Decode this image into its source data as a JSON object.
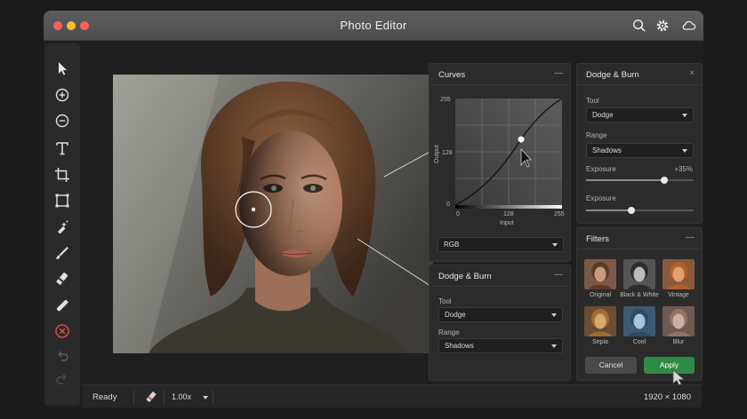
{
  "window": {
    "title": "Photo Editor"
  },
  "colors": {
    "accent": "#2f8a45",
    "panel": "#2b2b2c",
    "traffic": [
      "#ff5f57",
      "#febc2e",
      "#ff5f57"
    ]
  },
  "title_icons": [
    "search-icon",
    "gear-icon",
    "cloud-icon"
  ],
  "toolbar": {
    "tools": [
      "pointer",
      "zoom-in",
      "zoom-out",
      "text",
      "crop",
      "rectangle",
      "healing",
      "brush",
      "eraser",
      "dodge",
      "delete",
      "undo",
      "redo"
    ]
  },
  "curves": {
    "title": "Curves",
    "collapse": "—",
    "y_ticks": [
      "255",
      "128",
      "0"
    ],
    "x_ticks": [
      "0",
      "128",
      "255"
    ],
    "y_label": "Output",
    "x_label": "Input",
    "channel": "RGB"
  },
  "dodge_burn_left": {
    "title": "Dodge & Burn",
    "collapse": "—",
    "tool_label": "Tool",
    "tool_value": "Dodge",
    "range_label": "Range",
    "range_value": "Shadows"
  },
  "dodge_burn_right": {
    "title": "Dodge & Burn",
    "close": "×",
    "tool_label": "Tool",
    "tool_value": "Dodge",
    "range_label": "Range",
    "range_value": "Shadows",
    "exposure_label": "Exposure",
    "exposure_value": "+35%",
    "exposure_level": 0.73,
    "exposure2_label": "Exposure",
    "exposure2_level": 0.42
  },
  "filters": {
    "title": "Filters",
    "collapse": "—",
    "items": [
      "Original",
      "Black & White",
      "Vintage",
      "Sepia",
      "Cool",
      "Blur"
    ],
    "cancel": "Cancel",
    "apply": "Apply"
  },
  "status": {
    "ready": "Ready",
    "zoom": "1.00x",
    "dimensions": "1920 × 1080"
  }
}
